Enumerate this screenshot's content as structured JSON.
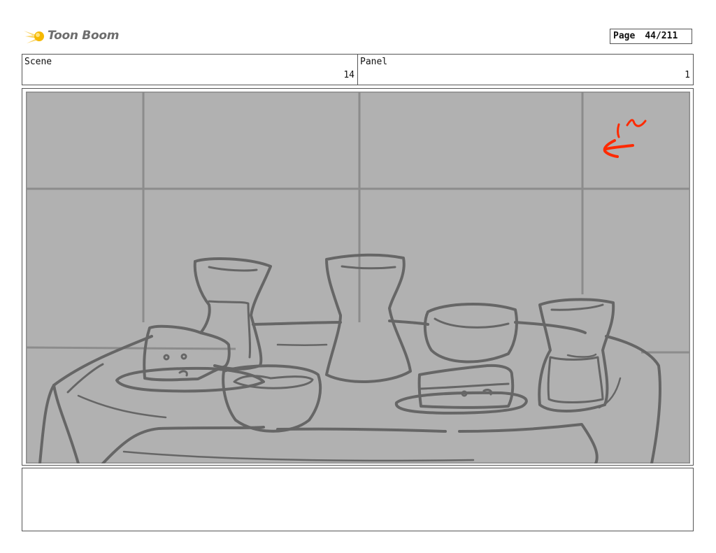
{
  "logo": {
    "text": "Toon Boom",
    "icon": "toon-boom-comet-icon",
    "accent": "#f5b800"
  },
  "page": {
    "label": "Page",
    "value": "44/211"
  },
  "header": {
    "scene_label": "Scene",
    "scene_value": "14",
    "panel_label": "Panel",
    "panel_value": "1"
  },
  "panel_image": {
    "description_icon": "storyboard-sketch-image",
    "background": "#b1b1b1",
    "line_color": "#666666",
    "annotation_color": "#ff2a00"
  },
  "notes": {
    "text": ""
  }
}
